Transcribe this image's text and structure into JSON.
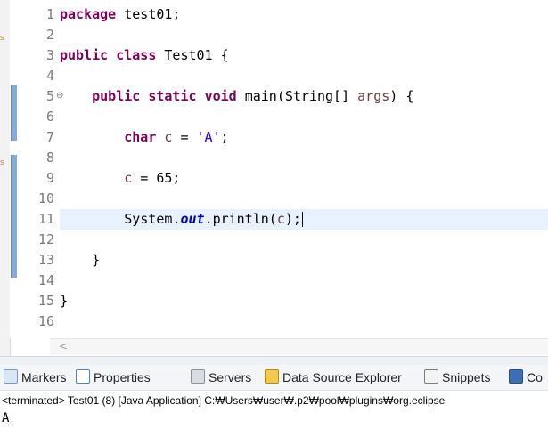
{
  "editor": {
    "line_numbers": [
      "1",
      "2",
      "3",
      "4",
      "5",
      "6",
      "7",
      "8",
      "9",
      "10",
      "11",
      "12",
      "13",
      "14",
      "15",
      "16"
    ],
    "fold_glyph": "⊖",
    "code": {
      "l1_kw": "package",
      "l1_rest": " test01;",
      "l3_kw1": "public",
      "l3_kw2": "class",
      "l3_rest": " Test01 {",
      "l5_indent": "    ",
      "l5_kw1": "public",
      "l5_kw2": "static",
      "l5_kw3": "void",
      "l5_mid": " main(String[] ",
      "l5_param": "args",
      "l5_end": ") {",
      "l7_indent": "        ",
      "l7_kw": "char",
      "l7_var": "c",
      "l7_eq": " = ",
      "l7_str": "'A'",
      "l7_end": ";",
      "l9_indent": "        ",
      "l9_var": "c",
      "l9_rest": " = 65;",
      "l11_indent": "        ",
      "l11_sys": "System.",
      "l11_field": "out",
      "l11_call": ".println(",
      "l11_var": "c",
      "l11_end": ");",
      "l13_text": "    }",
      "l15_text": "}"
    },
    "hscroll_left": "<"
  },
  "views": {
    "tabs": [
      {
        "label": "Markers",
        "icon": "markers-icon"
      },
      {
        "label": "Properties",
        "icon": "properties-icon"
      },
      {
        "label": "Servers",
        "icon": "servers-icon"
      },
      {
        "label": "Data Source Explorer",
        "icon": "data-source-explorer-icon"
      },
      {
        "label": "Snippets",
        "icon": "snippets-icon"
      },
      {
        "label": "Co",
        "icon": "console-icon"
      }
    ]
  },
  "console": {
    "header": "<terminated> Test01 (8) [Java Application] C:₩Users₩user₩.p2₩pool₩plugins₩org.eclipse",
    "output": "A"
  },
  "colors": {
    "keyword": "#7f0055",
    "string": "#2a00ff",
    "field": "#0000c0",
    "variable": "#6a3e3e",
    "current_line": "#e8f2fe"
  }
}
